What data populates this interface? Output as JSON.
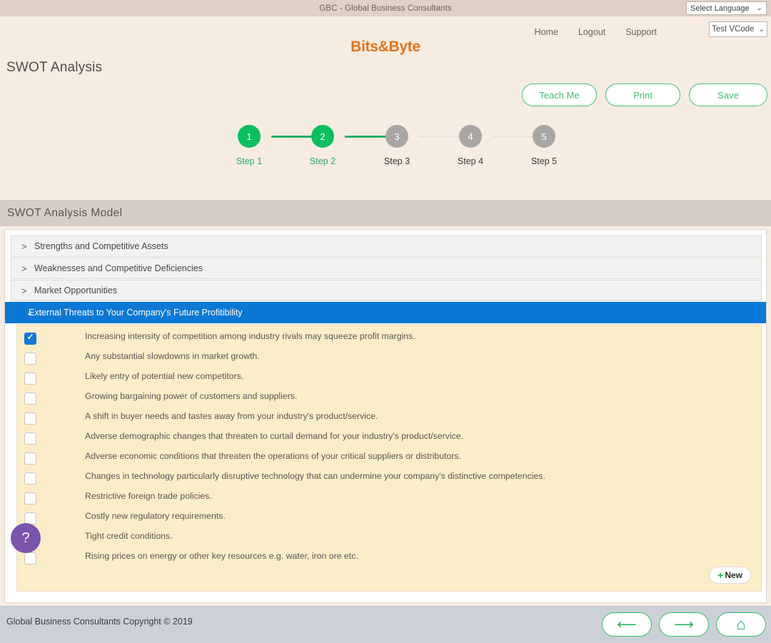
{
  "topbar": {
    "title": "GBC - Global Business Consultants",
    "language_select": {
      "value": "Select Language",
      "chevron": "chevron-down-icon"
    }
  },
  "header": {
    "nav": [
      {
        "label": "Home"
      },
      {
        "label": "Logout"
      },
      {
        "label": "Support"
      }
    ],
    "account_select": {
      "value": "Test VCode",
      "chevron": "chevron-down-icon"
    },
    "logo": "Bits&Byte",
    "page_title": "SWOT Analysis",
    "actions": [
      {
        "label": "Teach Me"
      },
      {
        "label": "Print"
      },
      {
        "label": "Save"
      }
    ]
  },
  "stepper": {
    "steps": [
      {
        "number": "1",
        "label": "Step 1",
        "state": "done"
      },
      {
        "number": "2",
        "label": "Step 2",
        "state": "done"
      },
      {
        "number": "3",
        "label": "Step 3",
        "state": "todo"
      },
      {
        "number": "4",
        "label": "Step 4",
        "state": "todo"
      },
      {
        "number": "5",
        "label": "Step 5",
        "state": "todo"
      }
    ],
    "connectors": [
      "on",
      "on",
      "off",
      "off"
    ]
  },
  "section": {
    "header": "SWOT Analysis Model",
    "accordions": [
      {
        "label": "Strengths and Competitive Assets",
        "arrow": ">",
        "active": false
      },
      {
        "label": "Weaknesses and Competitive Deficiencies",
        "arrow": ">",
        "active": false
      },
      {
        "label": "Market Opportunities",
        "arrow": ">",
        "active": false
      },
      {
        "label": "External Threats to Your Company's Future Profitibility",
        "arrow": "⌄",
        "active": true
      }
    ]
  },
  "checklist": {
    "items": [
      {
        "text": "Increasing intensity of competition among industry rivals may squeeze profit margins.",
        "checked": true
      },
      {
        "text": "Any substantial slowdowns in market growth.",
        "checked": false
      },
      {
        "text": "Likely entry of potential new competitors.",
        "checked": false
      },
      {
        "text": "Growing bargaining power of customers and suppliers.",
        "checked": false
      },
      {
        "text": "A shift in buyer needs and tastes away from your industry's product/service.",
        "checked": false
      },
      {
        "text": "Adverse demographic changes that threaten to curtail demand for your industry's product/service.",
        "checked": false
      },
      {
        "text": "Adverse economic conditions that threaten the operations of your critical suppliers or distributors.",
        "checked": false
      },
      {
        "text": "Changes in technology particularly disruptive technology that can undermine your company's distinctive competencies.",
        "checked": false
      },
      {
        "text": "Restrictive foreign trade policies.",
        "checked": false
      },
      {
        "text": "Costly new regulatory requirements.",
        "checked": false
      },
      {
        "text": "Tight credit conditions.",
        "checked": false
      },
      {
        "text": "Rising prices on energy or other key resources e.g. water, iron ore etc.",
        "checked": false
      }
    ],
    "new_button": {
      "plus": "+",
      "label": "New"
    }
  },
  "help_button": {
    "label": "?"
  },
  "footer": {
    "copyright": "Global Business Consultants Copyright © 2019",
    "nav": [
      {
        "icon": "arrow-left-icon",
        "glyph": "⟵"
      },
      {
        "icon": "arrow-right-icon",
        "glyph": "⟶"
      },
      {
        "icon": "home-icon",
        "glyph": "⌂"
      }
    ]
  },
  "colors": {
    "accent_green": "#23b066",
    "accent_blue": "#0a78d4",
    "logo_orange": "#e2731c",
    "help_purple": "#7a54ad",
    "list_bg": "#fcedc9"
  }
}
